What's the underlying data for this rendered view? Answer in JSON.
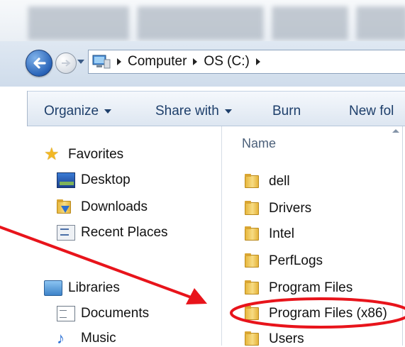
{
  "breadcrumb": {
    "items": [
      "Computer",
      "OS (C:)"
    ]
  },
  "toolbar": {
    "organize": "Organize",
    "share_with": "Share with",
    "burn": "Burn",
    "new_folder": "New fol"
  },
  "nav": {
    "favorites_label": "Favorites",
    "favorites": [
      "Desktop",
      "Downloads",
      "Recent Places"
    ],
    "libraries_label": "Libraries",
    "libraries": [
      "Documents",
      "Music"
    ]
  },
  "files": {
    "column_name": "Name",
    "items": [
      "dell",
      "Drivers",
      "Intel",
      "PerfLogs",
      "Program Files",
      "Program Files (x86)",
      "Users"
    ]
  },
  "icons": {
    "back": "back-arrow-icon",
    "forward": "forward-arrow-icon",
    "history": "dropdown-icon",
    "location": "computer-icon",
    "favorites": "star-icon",
    "desktop": "desktop-icon",
    "downloads": "downloads-folder-icon",
    "recent": "recent-places-icon",
    "libraries": "library-icon",
    "documents": "document-icon",
    "music": "music-icon",
    "folder": "folder-icon"
  },
  "colors": {
    "annotation": "#e8141b",
    "toolbar_text": "#1e3f6b",
    "folder": "#f0c94e",
    "back_button": "#2a64b8"
  }
}
